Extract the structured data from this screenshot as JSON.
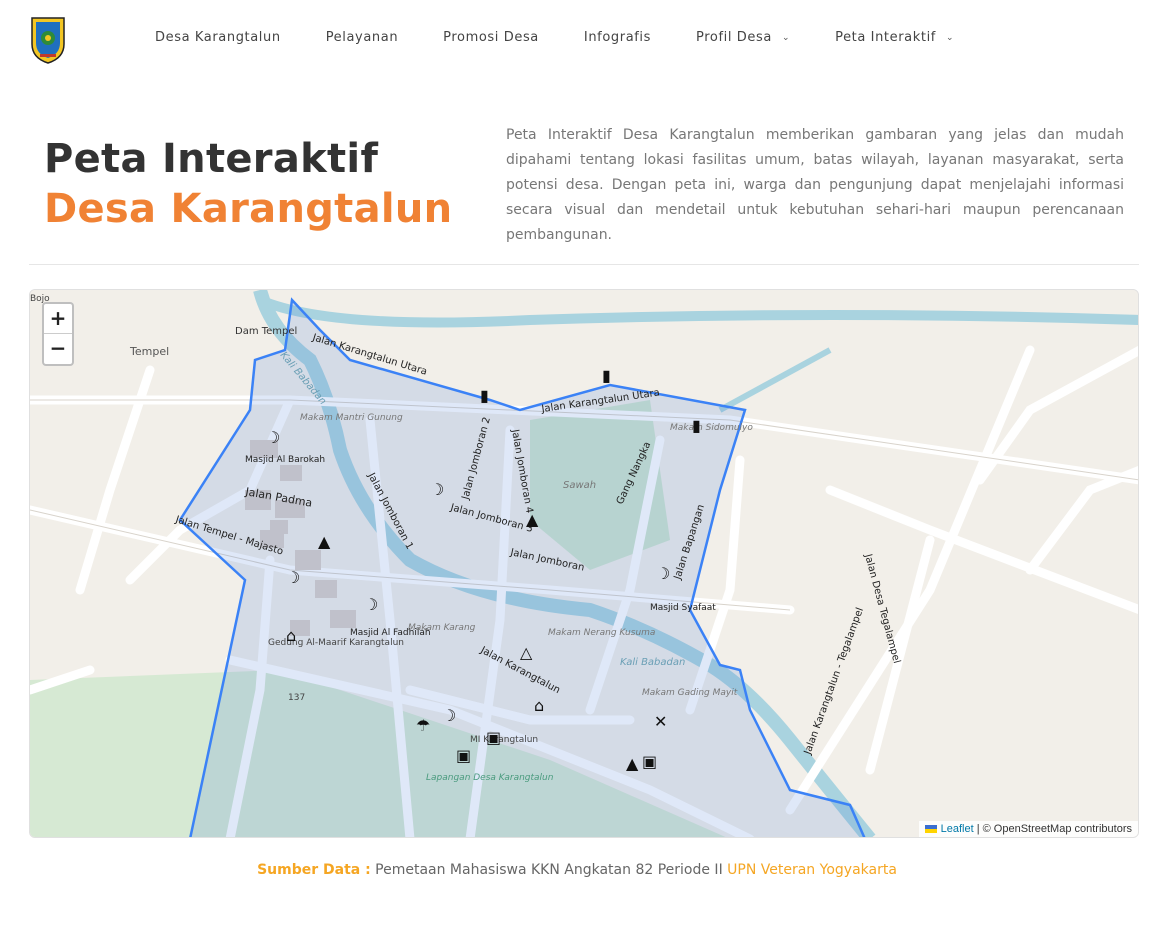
{
  "nav": {
    "items": [
      {
        "label": "Desa Karangtalun",
        "dropdown": false
      },
      {
        "label": "Pelayanan",
        "dropdown": false
      },
      {
        "label": "Promosi Desa",
        "dropdown": false
      },
      {
        "label": "Infografis",
        "dropdown": false
      },
      {
        "label": "Profil Desa",
        "dropdown": true
      },
      {
        "label": "Peta Interaktif",
        "dropdown": true
      }
    ]
  },
  "hero": {
    "title_line1": "Peta Interaktif",
    "title_line2": "Desa Karangtalun",
    "description": "Peta Interaktif Desa Karangtalun memberikan gambaran yang jelas dan mudah dipahami tentang lokasi fasilitas umum, batas wilayah, layanan masyarakat, serta potensi desa. Dengan peta ini, warga dan pengunjung dapat menjelajahi informasi secara visual dan mendetail untuk kebutuhan sehari-hari maupun perencanaan pembangunan."
  },
  "map": {
    "zoom_in": "+",
    "zoom_out": "−",
    "attribution_link": "Leaflet",
    "attribution_text": " | © OpenStreetMap contributors",
    "labels": {
      "bojo": "Bojo",
      "dam_tempel": "Dam Tempel",
      "tempel": "Tempel",
      "jalan_karangtalun_utara_1": "Jalan Karangtalun Utara",
      "jalan_karangtalun_utara_2": "Jalan Karangtalun Utara",
      "kali_babadan_1": "Kali Babadan",
      "kali_babadan_2": "Kali Babadan",
      "makam_mantri_gunung": "Makam Mantri Gunung",
      "masjid_al_barokah": "Masjid Al Barokah",
      "jalan_padma": "Jalan Padma",
      "jalan_tempel_majasto": "Jalan Tempel - Majasto",
      "jalan_jomboran_1": "Jalan Jomboran 1",
      "jalan_jomboran_2": "Jalan Jomboran 2",
      "jalan_jomboran_3": "Jalan Jomboran 3",
      "jalan_jomboran_4": "Jalan Jomboran 4",
      "jalan_jomboran": "Jalan Jomboran",
      "sawah": "Sawah",
      "gang_nangka": "Gang Nangka",
      "jalan_bapangan": "Jalan Bapangan",
      "makam_sidomulyo": "Makam Sidomulyo",
      "masjid_syafaat": "Masjid Syafaat",
      "masjid_al_fadhilah": "Masjid Al Fadhilah",
      "makam_karang": "Makam Karang",
      "makam_nerang_kusuma": "Makam Nerang Kusuma",
      "jalan_karangtalun": "Jalan Karangtalun",
      "gedung_al_maarif": "Gedung Al-Maarif Karangtalun",
      "road_137": "137",
      "mi_karangtalun": "MI Karangtalun",
      "lapangan": "Lapangan Desa Karangtalun",
      "makam_gading": "Makam Gading Mayit",
      "jalan_desa_tegalampel": "Jalan Desa Tegalampel",
      "jalan_karangtalun_tegalampel": "Jalan Karangtalun - Tegalampel"
    }
  },
  "source": {
    "label": "Sumber Data :",
    "text": " Pemetaan Mahasiswa KKN Angkatan 82 Periode II ",
    "org": "UPN Veteran Yogyakarta"
  },
  "colors": {
    "accent_orange": "#f08234",
    "source_gold": "#f5a623",
    "boundary_blue": "#3b82f6",
    "river": "#a9d3df"
  }
}
